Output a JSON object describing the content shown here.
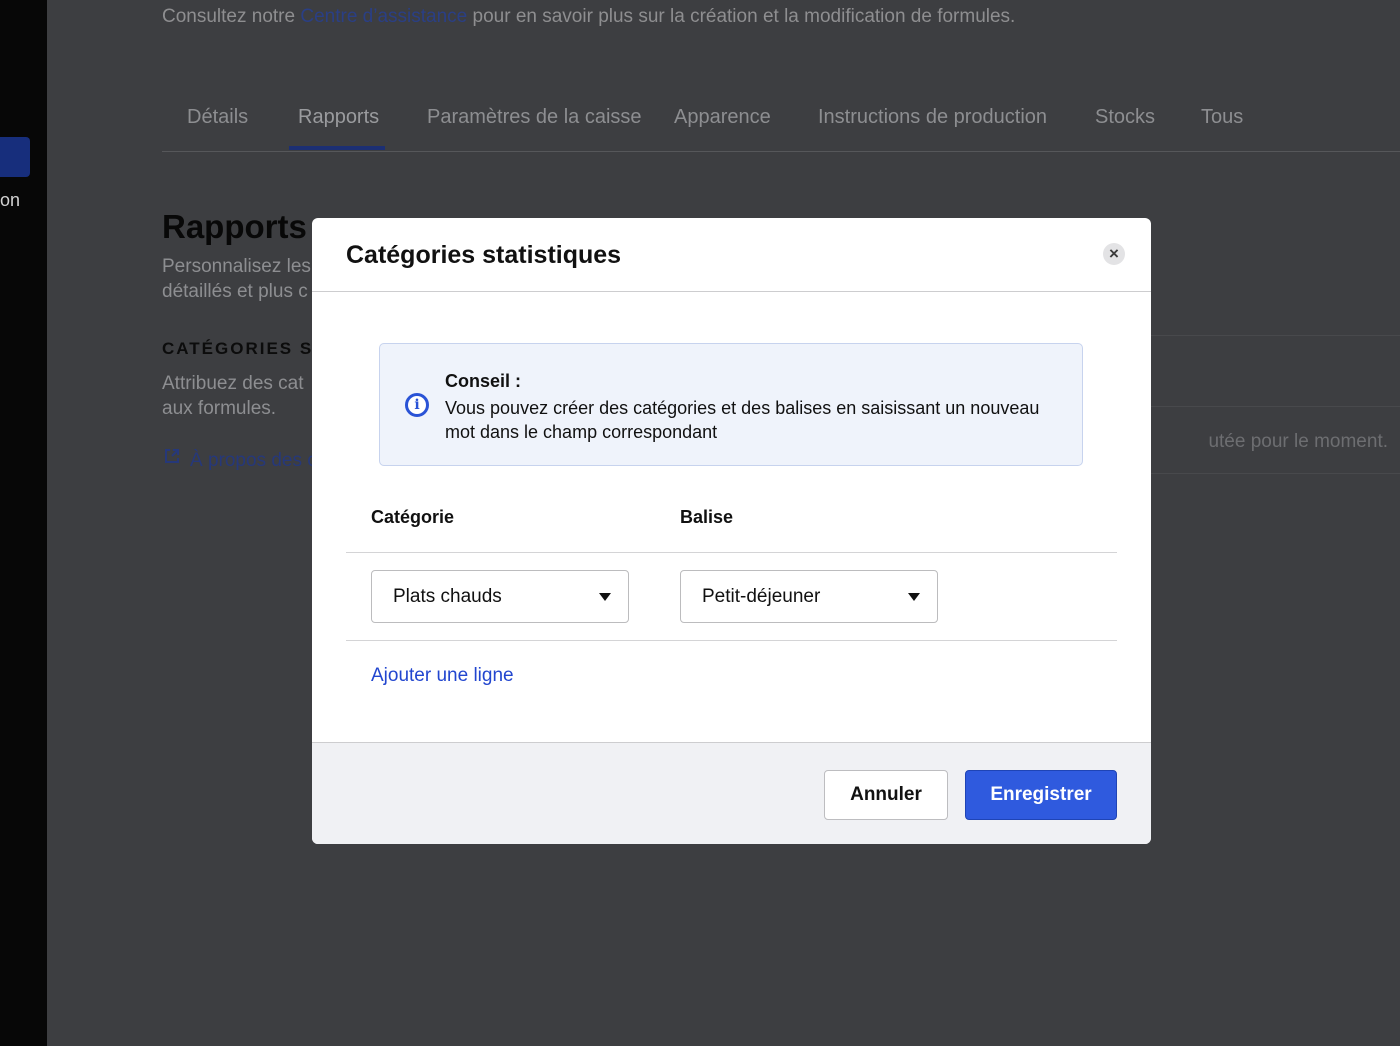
{
  "sidebar": {
    "partial_label": "on"
  },
  "page": {
    "help_prefix": "Consultez notre ",
    "help_link": "Centre d’assistance",
    "help_suffix": " pour en savoir plus sur la création et la modification de formules.",
    "tabs": [
      {
        "label": "Détails"
      },
      {
        "label": "Rapports",
        "active": true
      },
      {
        "label": "Paramètres de la caisse"
      },
      {
        "label": "Apparence"
      },
      {
        "label": "Instructions de production"
      },
      {
        "label": "Stocks"
      },
      {
        "label": "Tous"
      }
    ],
    "section_title": "Rapports",
    "section_desc_line1": "Personnalisez les",
    "section_desc_line2": "détaillés et plus c",
    "subhead": "CATÉGORIES ST",
    "subdesc_line1": "Attribuez des cat",
    "subdesc_line2": "aux formules.",
    "about_link": "À propos des c",
    "empty_text": "utée pour le moment."
  },
  "modal": {
    "title": "Catégories statistiques",
    "tip_title": "Conseil :",
    "tip_text": "Vous pouvez créer des catégories et des balises en saisissant un nouveau mot dans le champ correspondant",
    "col_category": "Catégorie",
    "col_tag": "Balise",
    "row": {
      "category_value": "Plats chauds",
      "tag_value": "Petit-déjeuner"
    },
    "add_line": "Ajouter une ligne",
    "cancel_label": "Annuler",
    "save_label": "Enregistrer"
  },
  "colors": {
    "primary": "#2f5ade",
    "link": "#2246cf",
    "overlay": "#3d3e41"
  }
}
